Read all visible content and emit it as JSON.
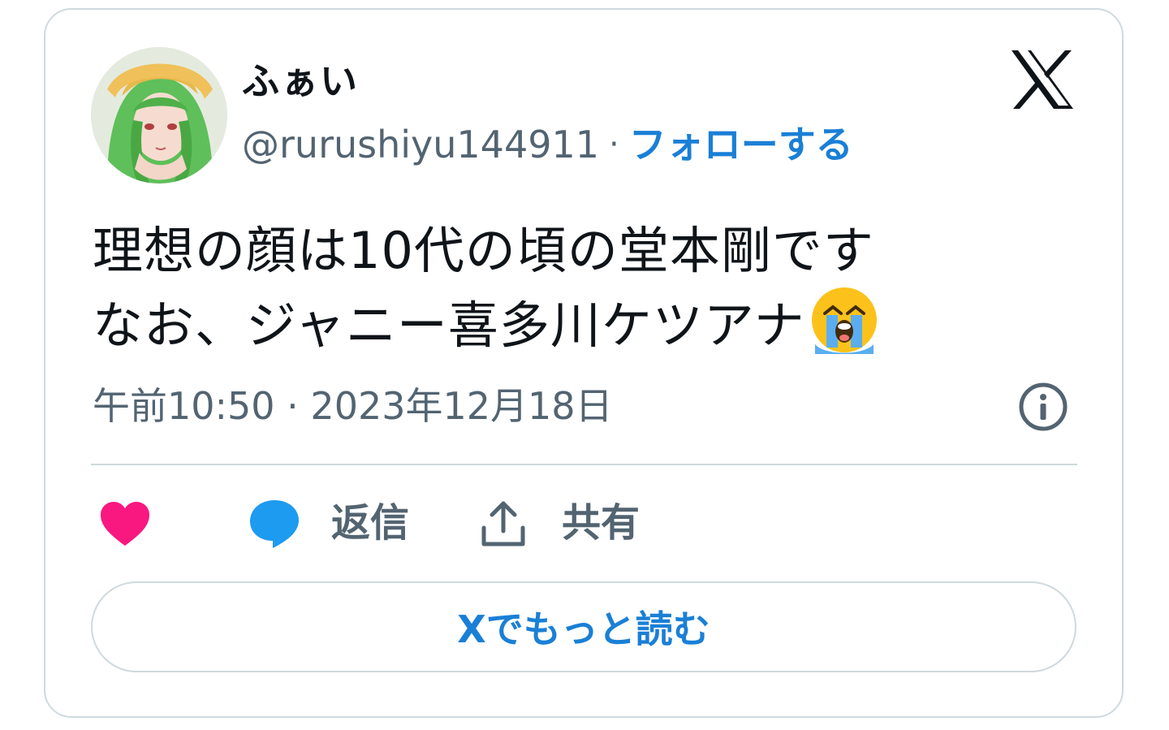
{
  "author": {
    "display_name": "ふぁい",
    "handle": "@rurushiyu144911",
    "separator": "·",
    "follow_label": "フォローする"
  },
  "tweet": {
    "line1": "理想の顔は10代の頃の堂本剛です",
    "line2": "なお、ジャニー喜多川ケツアナ",
    "emoji": "loudly-crying-face"
  },
  "timestamp": "午前10:50 · 2023年12月18日",
  "actions": {
    "reply_label": "返信",
    "share_label": "共有"
  },
  "read_more_label": "Xでもっと読む",
  "colors": {
    "accent": "#1a7fd6",
    "like": "#f91880",
    "reply_bubble": "#1d9bf0",
    "secondary_text": "#536471",
    "border": "#cfd9de"
  }
}
